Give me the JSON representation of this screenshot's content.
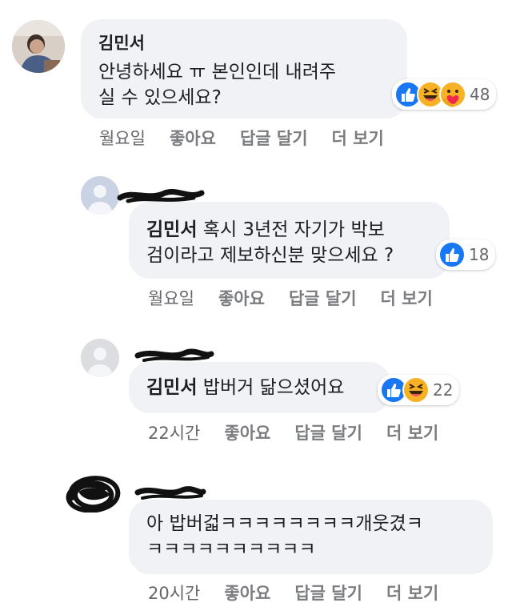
{
  "comments": [
    {
      "author": "김민서",
      "text": "안녕하세요 ㅠ 본인인데 내려주\n실 수 있으세요?",
      "reaction_count": "48",
      "reactions": [
        "like-icon",
        "haha-icon",
        "care-icon"
      ],
      "time": "월요일",
      "like_label": "좋아요",
      "reply_label": "답글 달기",
      "more_label": "더 보기"
    },
    {
      "mention": "김민서",
      "text": " 혹시 3년전 자기가 박보\n검이라고 제보하신분 맞으세요 ?",
      "reaction_count": "18",
      "reactions": [
        "like-icon"
      ],
      "time": "월요일",
      "like_label": "좋아요",
      "reply_label": "답글 달기",
      "more_label": "더 보기"
    },
    {
      "mention": "김민서",
      "text": " 밥버거 닮으셨어요",
      "reaction_count": "22",
      "reactions": [
        "like-icon",
        "haha-icon"
      ],
      "time": "22시간",
      "like_label": "좋아요",
      "reply_label": "답글 달기",
      "more_label": "더 보기"
    },
    {
      "text": "아 밥버걻ㅋㅋㅋㅋㅋㅋㅋㅋ개웃겼ㅋ\nㅋㅋㅋㅋㅋㅋㅋㅋㅋㅋ",
      "time": "20시간",
      "like_label": "좋아요",
      "reply_label": "답글 달기",
      "more_label": "더 보기"
    }
  ],
  "colors": {
    "bubble": "#f0f2f5",
    "like_blue": "#1877f2",
    "haha_yellow": "#f7b125",
    "muted_text": "#65676b"
  }
}
